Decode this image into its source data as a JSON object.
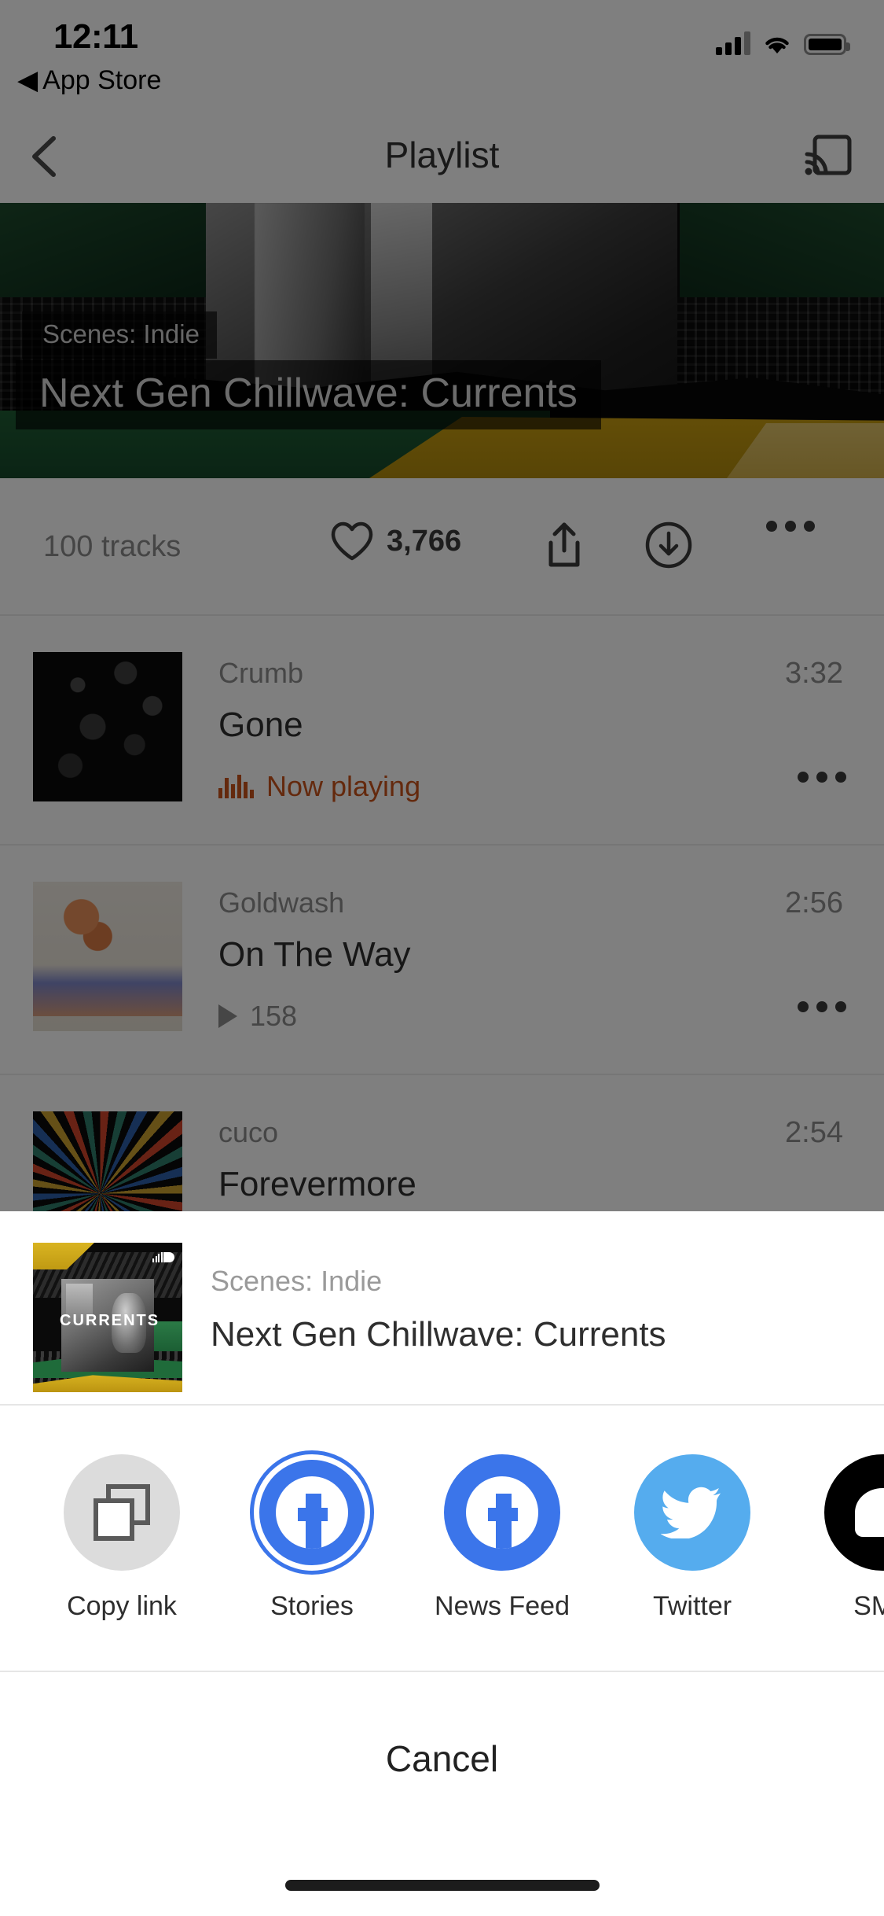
{
  "status_bar": {
    "time": "12:11",
    "back_app": "App Store",
    "back_caret": "◀",
    "signal_icon": "cellular-signal-icon",
    "wifi_icon": "wifi-icon",
    "battery_icon": "battery-icon"
  },
  "nav": {
    "title": "Playlist",
    "back_icon": "chevron-left-icon",
    "cast_icon": "cast-icon"
  },
  "hero": {
    "tag": "Scenes: Indie",
    "title": "Next Gen Chillwave: Currents"
  },
  "action_bar": {
    "track_count": "100 tracks",
    "likes": "3,766",
    "like_icon": "heart-icon",
    "share_icon": "share-icon",
    "download_icon": "download-icon",
    "more_icon": "more-horizontal-icon"
  },
  "tracks": [
    {
      "artist": "Crumb",
      "title": "Gone",
      "duration": "3:32",
      "meta": "Now playing",
      "meta_type": "playing",
      "art": "art-crumb",
      "more_icon": "more-horizontal-icon"
    },
    {
      "artist": "Goldwash",
      "title": "On The Way",
      "duration": "2:56",
      "meta": "158",
      "meta_type": "plays",
      "art": "art-goldwash",
      "more_icon": "more-horizontal-icon"
    },
    {
      "artist": "cuco",
      "title": "Forevermore",
      "duration": "2:54",
      "meta": "",
      "meta_type": "plays",
      "art": "art-cuco",
      "more_icon": "more-horizontal-icon"
    }
  ],
  "share_sheet": {
    "header": {
      "tag": "Scenes: Indie",
      "title": "Next Gen Chillwave: Currents",
      "thumb_label": "CURRENTS",
      "thumb_logo_icon": "soundcloud-logo-icon"
    },
    "options": [
      {
        "label": "Copy link",
        "icon": "copy-link-icon",
        "bg": "#dcdcdc"
      },
      {
        "label": "Stories",
        "icon": "facebook-stories-icon",
        "bg": "#3b75ea"
      },
      {
        "label": "News Feed",
        "icon": "facebook-icon",
        "bg": "#3b75ea"
      },
      {
        "label": "Twitter",
        "icon": "twitter-icon",
        "bg": "#55acee"
      },
      {
        "label": "SMS",
        "icon": "sms-icon",
        "bg": "#000000"
      }
    ],
    "cancel_label": "Cancel"
  },
  "colors": {
    "accent_orange": "#c8521a",
    "facebook_blue": "#3b75ea",
    "twitter_blue": "#55acee",
    "sms_black": "#000000",
    "copy_gray": "#dcdcdc",
    "overlay": "rgba(0,0,0,0.50)"
  }
}
